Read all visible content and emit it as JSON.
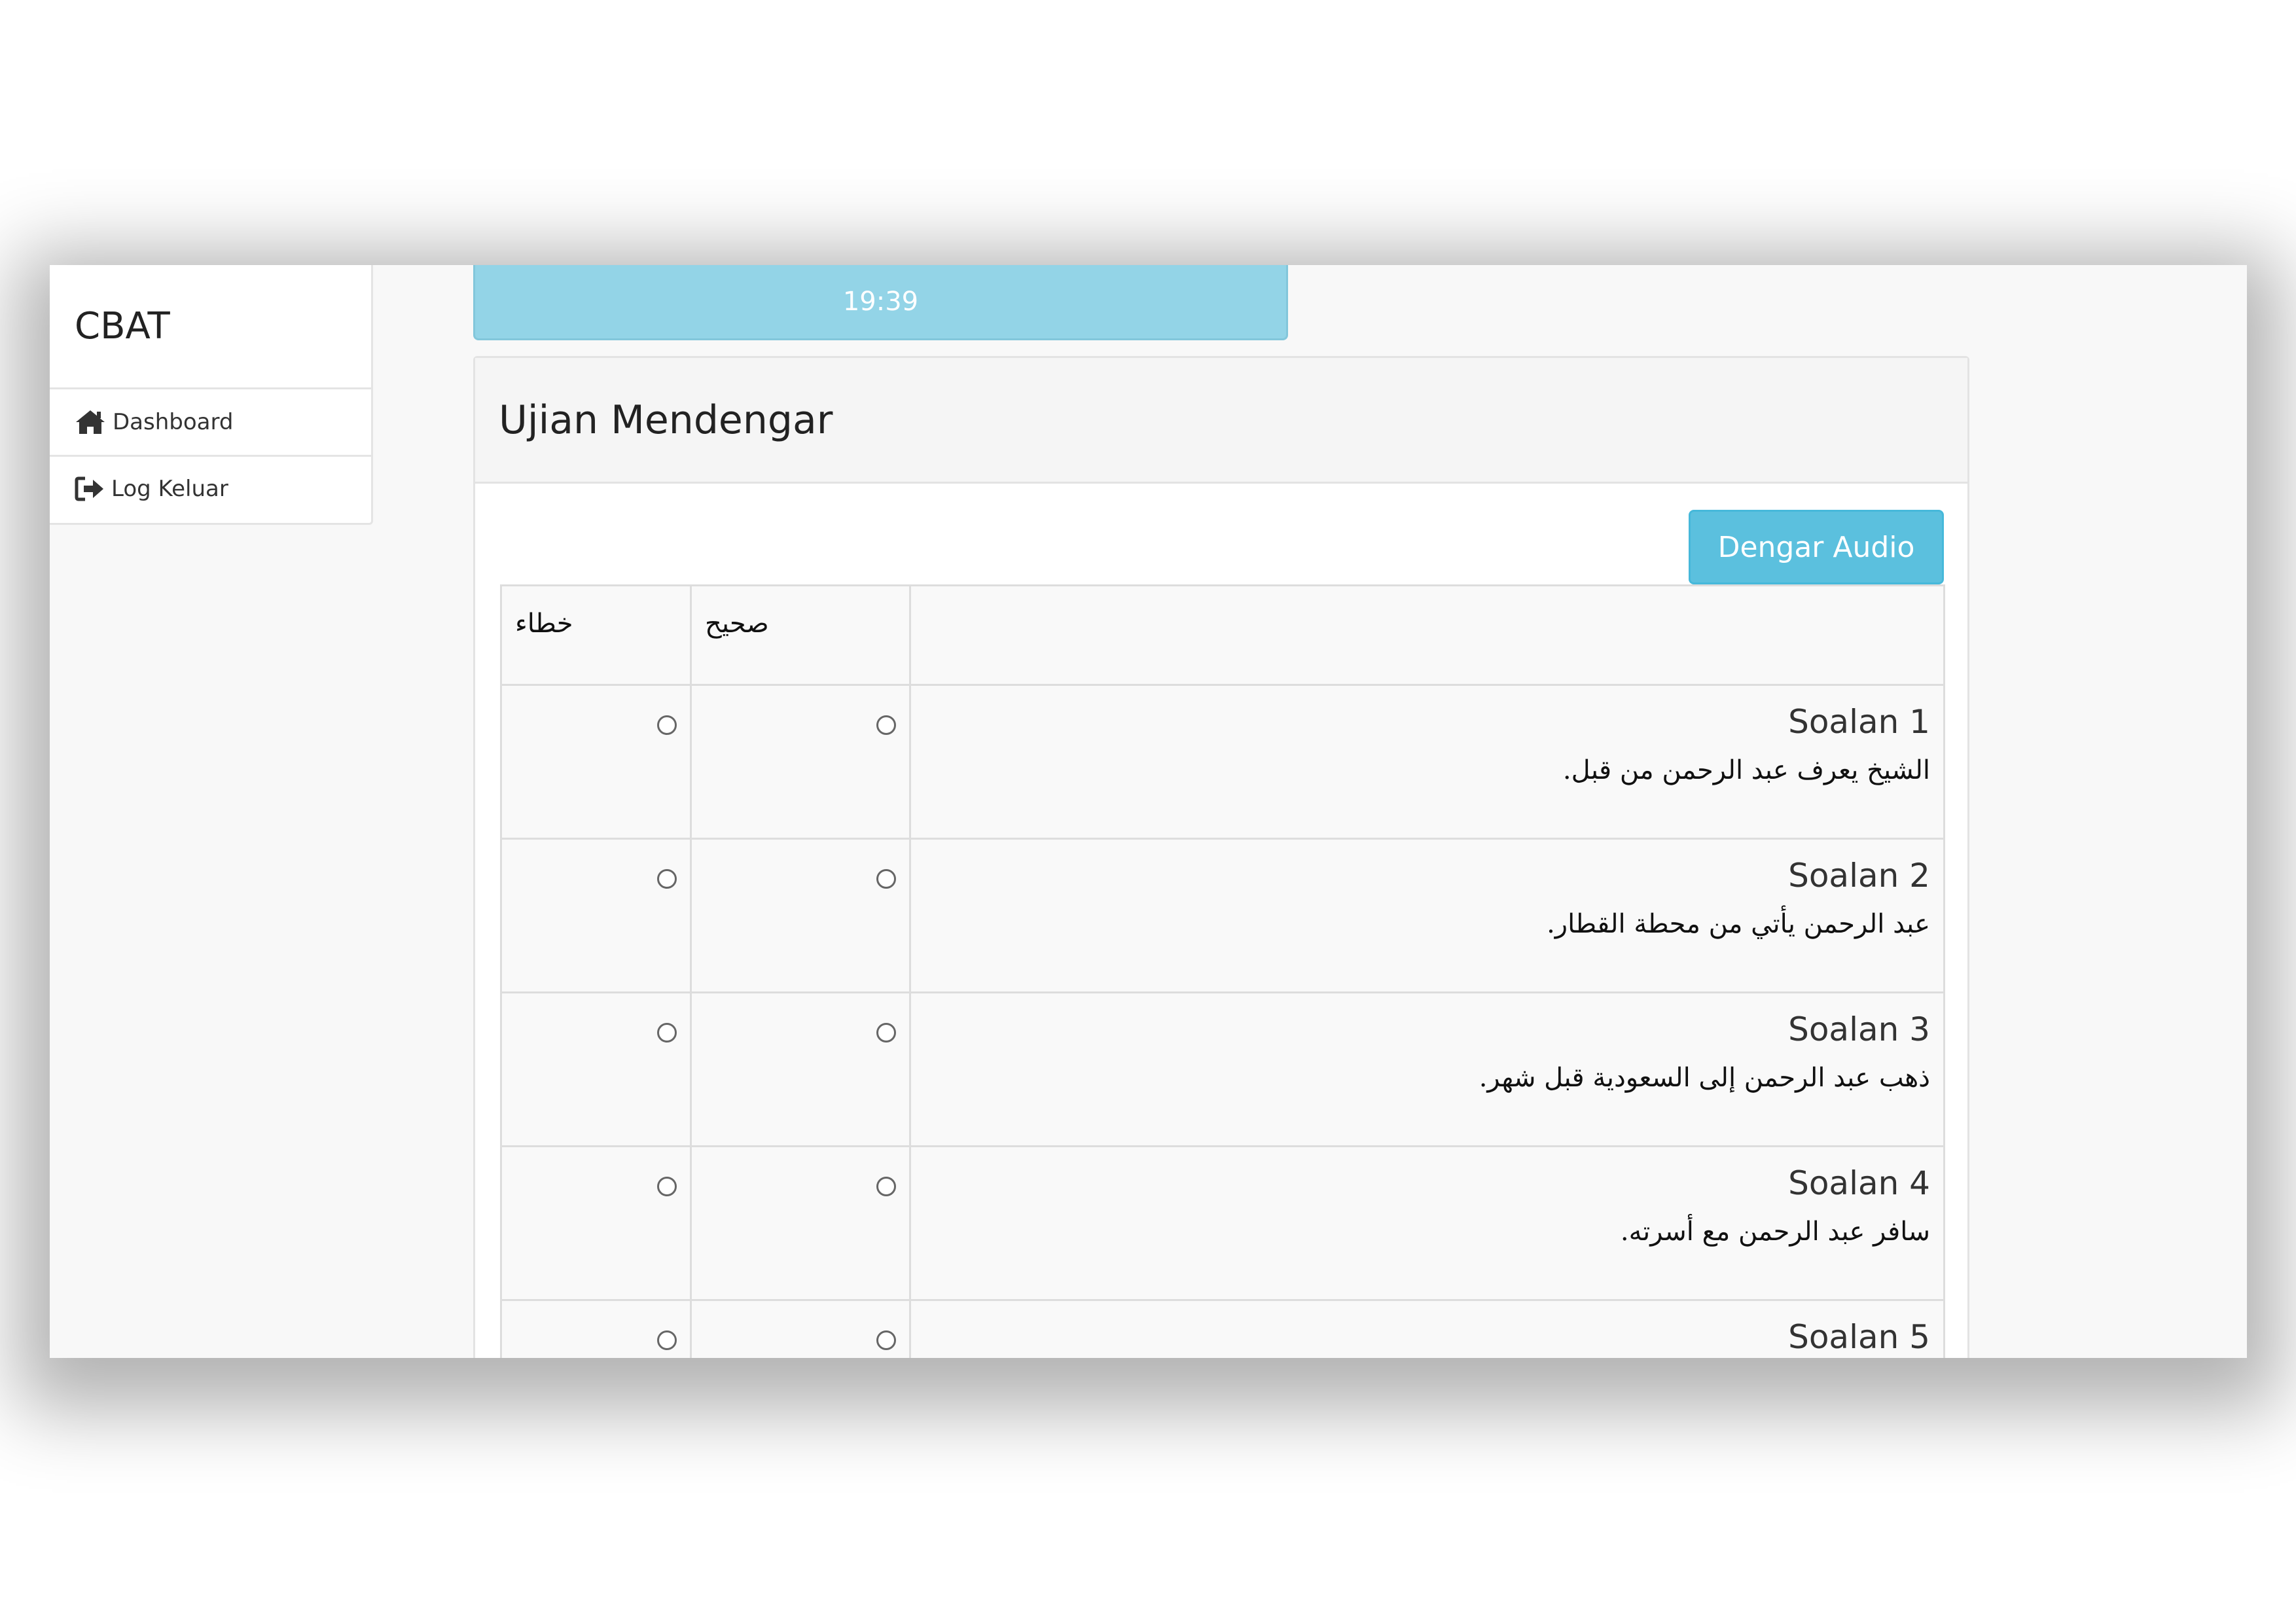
{
  "sidebar": {
    "brand": "CBAT",
    "items": [
      {
        "label": "Dashboard",
        "icon": "home-icon"
      },
      {
        "label": "Log Keluar",
        "icon": "sign-out-icon"
      }
    ]
  },
  "timer": "19:39",
  "panel": {
    "title": "Ujian Mendengar",
    "audio_button": "Dengar Audio"
  },
  "table": {
    "headers": {
      "wrong": "خطاء",
      "right": "صحيح",
      "question": ""
    },
    "questions": [
      {
        "title": "Soalan 1",
        "text": "الشيخ يعرف عبد الرحمن من قبل."
      },
      {
        "title": "Soalan 2",
        "text": "عبد الرحمن يأتي من محطة القطار."
      },
      {
        "title": "Soalan 3",
        "text": "ذهب عبد الرحمن إلى السعودية قبل شهر."
      },
      {
        "title": "Soalan 4",
        "text": "سافر عبد الرحمن مع أسرته."
      },
      {
        "title": "Soalan 5",
        "text": ""
      }
    ]
  },
  "colors": {
    "timer_bg": "#93d4e7",
    "button_bg": "#5bc0de"
  }
}
